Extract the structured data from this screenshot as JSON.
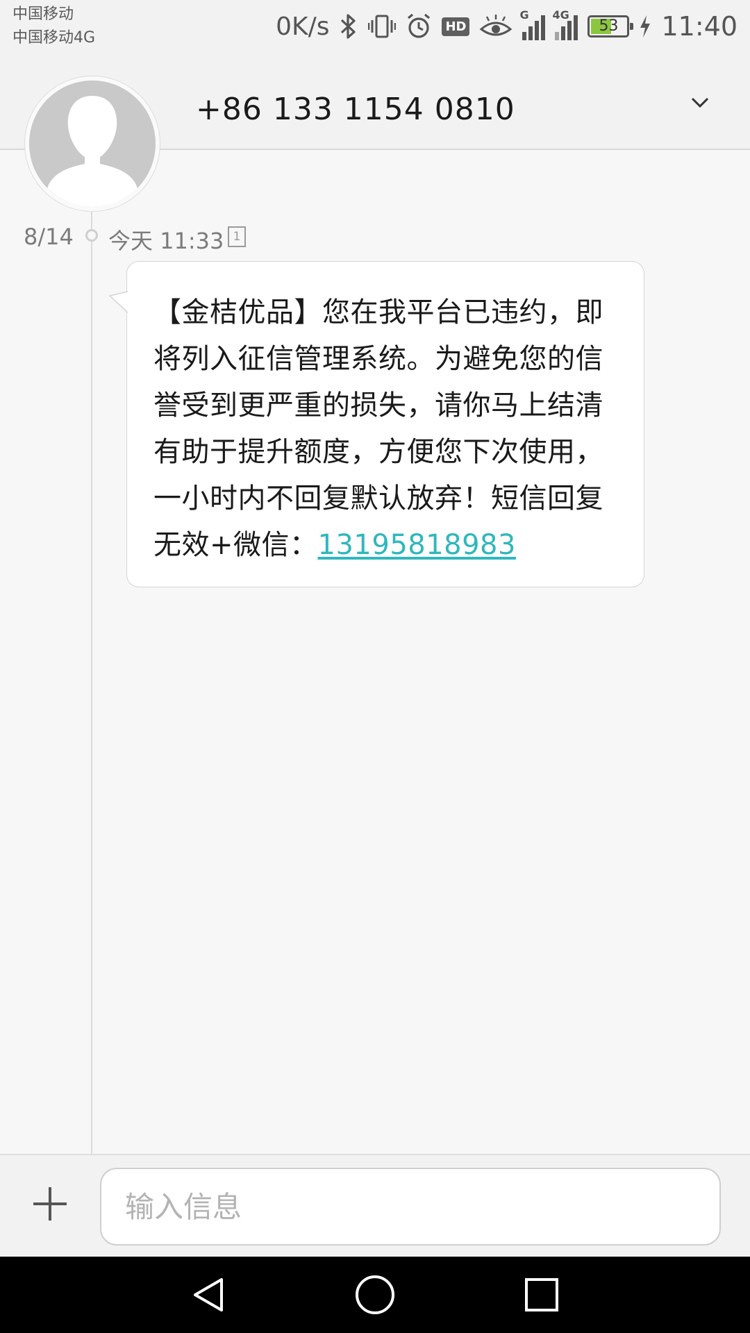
{
  "status_bar": {
    "carrier_1": "中国移动",
    "carrier_2": "中国移动4G",
    "net_speed": "0K/s",
    "hd_label": "HD",
    "signal_1_type": "G",
    "signal_2_type": "4G",
    "battery_level": "53",
    "battery_fraction": 0.53,
    "time": "11:40",
    "icons": [
      "bluetooth-icon",
      "vibrate-icon",
      "alarm-icon",
      "hd-icon",
      "eye-comfort-icon",
      "signal-icon",
      "signal-4g-icon",
      "battery-icon",
      "charging-icon"
    ]
  },
  "header": {
    "contact_number": "+86 133 1154 0810",
    "expand_icon": "chevron-down-icon",
    "avatar_icon": "default-contact-avatar"
  },
  "conversation": {
    "date": "8/14",
    "time": "今天 11:33",
    "sim_label": "1",
    "message": {
      "body": "【金桔优品】您在我平台已违约，即将列入征信管理系统。为避免您的信誉受到更严重的损失，请你马上结清有助于提升额度，方便您下次使用，一小时内不回复默认放弃！短信回复无效+微信：",
      "link": "13195818983"
    }
  },
  "compose": {
    "attach_icon": "plus-icon",
    "placeholder": "输入信息"
  },
  "nav": {
    "back_icon": "back-triangle-icon",
    "home_icon": "home-circle-icon",
    "recent_icon": "recent-square-icon"
  },
  "colors": {
    "link": "#2fb7bd",
    "battery_fill": "#8cc63f",
    "background": "#f7f7f7"
  }
}
